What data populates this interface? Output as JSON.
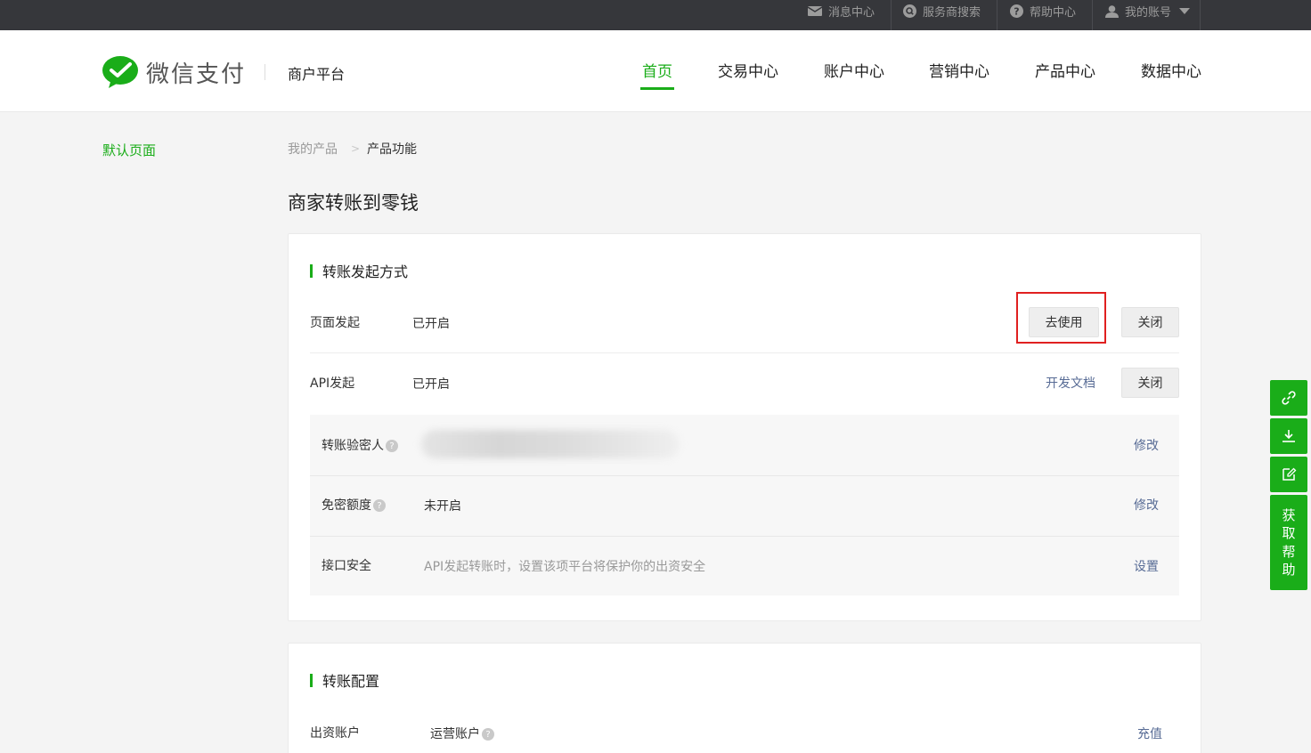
{
  "topbar": {
    "messages": "消息中心",
    "provider_search": "服务商搜索",
    "help": "帮助中心",
    "account": "我的账号"
  },
  "header": {
    "logo_text": "微信支付",
    "platform": "商户平台",
    "nav": [
      "首页",
      "交易中心",
      "账户中心",
      "营销中心",
      "产品中心",
      "数据中心"
    ],
    "active_nav": "首页"
  },
  "sidebar": {
    "default_page": "默认页面"
  },
  "breadcrumb": {
    "level1": "我的产品",
    "separator": ">",
    "level2": "产品功能"
  },
  "page_title": "商家转账到零钱",
  "section1": {
    "title": "转账发起方式",
    "page_initiate": {
      "label": "页面发起",
      "status": "已开启",
      "use_button": "去使用",
      "close_button": "关闭"
    },
    "api_initiate": {
      "label": "API发起",
      "status": "已开启",
      "doc_link": "开发文档",
      "close_button": "关闭"
    },
    "verifier": {
      "label": "转账验密人",
      "action": "修改"
    },
    "free_limit": {
      "label": "免密额度",
      "status": "未开启",
      "action": "修改"
    },
    "api_security": {
      "label": "接口安全",
      "desc": "API发起转账时，设置该项平台将保护你的出资安全",
      "action": "设置"
    }
  },
  "section2": {
    "title": "转账配置",
    "funding_account": {
      "label": "出资账户",
      "value": "运营账户",
      "action": "充值"
    }
  },
  "float_tools": {
    "help_text": [
      "获",
      "取",
      "帮",
      "助"
    ]
  },
  "colors": {
    "brand_green": "#1aad19",
    "link_blue": "#576b95",
    "highlight_red": "#e02020"
  }
}
